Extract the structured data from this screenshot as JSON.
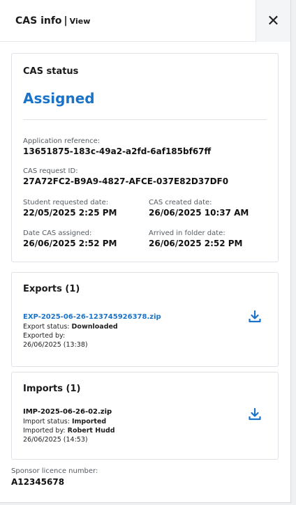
{
  "header": {
    "title": "CAS info",
    "separator": "|",
    "view_label": "View",
    "close_glyph": "✕"
  },
  "status_card": {
    "title": "CAS status",
    "status": "Assigned",
    "application_reference": {
      "label": "Application reference:",
      "value": "13651875-183c-49a2-a2fd-6af185bf67ff"
    },
    "cas_request_id": {
      "label": "CAS request ID:",
      "value": "27A72FC2-B9A9-4827-AFCE-037E82D37DF0"
    },
    "student_requested_date": {
      "label": "Student requested date:",
      "value": "22/05/2025 2:25 PM"
    },
    "cas_created_date": {
      "label": "CAS created date:",
      "value": "26/06/2025 10:37 AM"
    },
    "date_cas_assigned": {
      "label": "Date CAS assigned:",
      "value": "26/06/2025 2:52 PM"
    },
    "arrived_in_folder_date": {
      "label": "Arrived in folder date:",
      "value": "26/06/2025 2:52 PM"
    }
  },
  "exports": {
    "title": "Exports (1)",
    "file": "EXP-2025-06-26-123745926378.zip",
    "status_label": "Export status:",
    "status_value": "Downloaded",
    "by_label": "Exported by:",
    "by_value": "",
    "timestamp": "26/06/2025 (13:38)"
  },
  "imports": {
    "title": "Imports (1)",
    "file": "IMP-2025-06-26-02.zip",
    "status_label": "Import status:",
    "status_value": "Imported",
    "by_label": "Imported by:",
    "by_value": "Robert Hudd",
    "timestamp": "26/06/2025 (14:53)"
  },
  "sponsor": {
    "label": "Sponsor licence number:",
    "value": "A12345678"
  },
  "colors": {
    "accent": "#1a73c8",
    "border": "#dfe3e7",
    "background": "#eef0f2"
  },
  "icons": {
    "close": "close-icon",
    "download": "download-icon"
  }
}
